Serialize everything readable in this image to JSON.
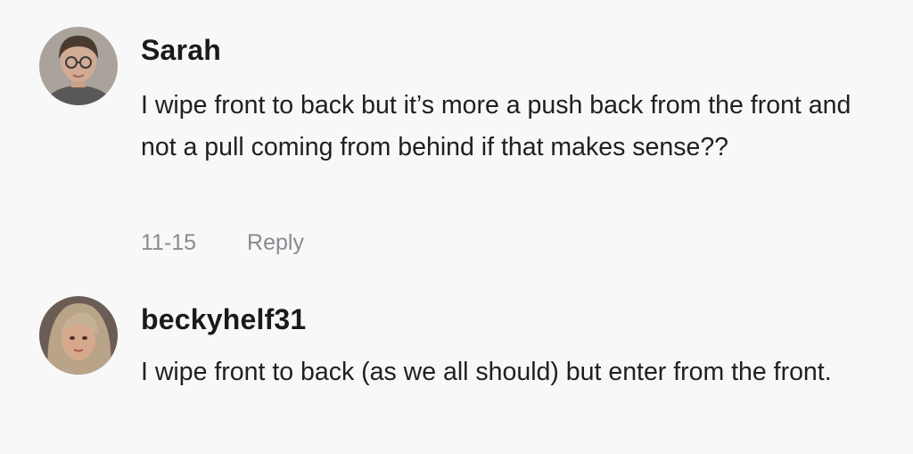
{
  "comments": [
    {
      "username": "Sarah",
      "text": "I wipe front to back but it’s more a push back from the front and not a pull coming from behind if that makes sense??",
      "date": "11-15",
      "reply_label": "Reply"
    },
    {
      "username": "beckyhelf31",
      "text": "I wipe front to back (as we all should) but enter from the front."
    }
  ],
  "colors": {
    "background": "#f8f8f8",
    "username": "#1a1a1a",
    "meta": "#8a8b91"
  }
}
